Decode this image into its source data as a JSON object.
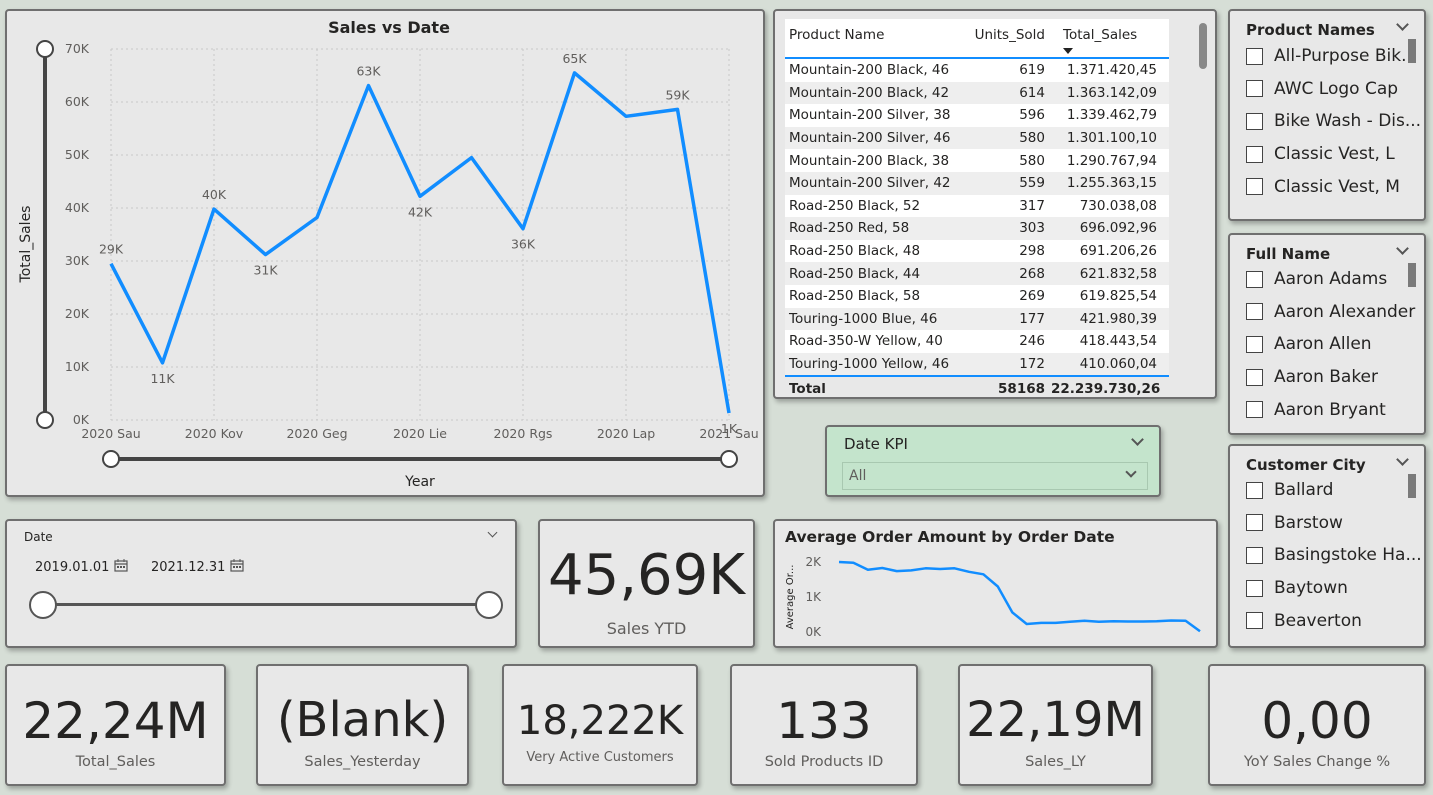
{
  "sales_chart": {
    "title": "Sales vs Date",
    "ylabel": "Total_Sales",
    "xlabel": "Year",
    "y_ticks": [
      "70K",
      "60K",
      "50K",
      "40K",
      "30K",
      "20K",
      "10K",
      "0K"
    ],
    "x_ticks": [
      "2020 Sau",
      "2020 Kov",
      "2020 Geg",
      "2020 Lie",
      "2020 Rgs",
      "2020 Lap",
      "2021 Sau"
    ]
  },
  "chart_data": [
    {
      "type": "line",
      "title": "Sales vs Date",
      "xlabel": "Year",
      "ylabel": "Total_Sales",
      "ylim": [
        0,
        70000
      ],
      "x_range": [
        "2020-01",
        "2021-01"
      ],
      "x": [
        "2020-01",
        "2020-02",
        "2020-03",
        "2020-04",
        "2020-05",
        "2020-06",
        "2020-07",
        "2020-08",
        "2020-09",
        "2020-10",
        "2020-11",
        "2020-12",
        "2021-01"
      ],
      "values": [
        29500,
        10800,
        39800,
        31200,
        38200,
        63100,
        42200,
        49500,
        36100,
        65500,
        57300,
        58600,
        1300
      ],
      "data_labels": [
        {
          "x": "2020-01",
          "text": "29K"
        },
        {
          "x": "2020-02",
          "text": "11K"
        },
        {
          "x": "2020-03",
          "text": "40K"
        },
        {
          "x": "2020-04",
          "text": "31K"
        },
        {
          "x": "2020-06",
          "text": "63K"
        },
        {
          "x": "2020-07",
          "text": "42K"
        },
        {
          "x": "2020-09",
          "text": "36K"
        },
        {
          "x": "2020-10",
          "text": "65K"
        },
        {
          "x": "2020-12",
          "text": "59K"
        },
        {
          "x": "2021-01",
          "text": "1K"
        }
      ],
      "grid": true,
      "color": "#118dff"
    },
    {
      "type": "line",
      "title": "Average Order Amount by Order Date",
      "ylabel": "Average Or...",
      "y_ticks": [
        "2K",
        "1K",
        "0K"
      ],
      "ylim": [
        0,
        2000
      ],
      "values": [
        2000,
        1980,
        1780,
        1830,
        1740,
        1760,
        1820,
        1800,
        1820,
        1720,
        1650,
        1300,
        560,
        230,
        260,
        260,
        290,
        320,
        290,
        310,
        300,
        300,
        310,
        330,
        320,
        20
      ],
      "grid": false,
      "color": "#118dff"
    }
  ],
  "product_table": {
    "headers": [
      "Product Name",
      "Units_Sold",
      "Total_Sales"
    ],
    "rows": [
      [
        "Mountain-200 Black, 46",
        "619",
        "1.371.420,45"
      ],
      [
        "Mountain-200 Black, 42",
        "614",
        "1.363.142,09"
      ],
      [
        "Mountain-200 Silver, 38",
        "596",
        "1.339.462,79"
      ],
      [
        "Mountain-200 Silver, 46",
        "580",
        "1.301.100,10"
      ],
      [
        "Mountain-200 Black, 38",
        "580",
        "1.290.767,94"
      ],
      [
        "Mountain-200 Silver, 42",
        "559",
        "1.255.363,15"
      ],
      [
        "Road-250 Black, 52",
        "317",
        "730.038,08"
      ],
      [
        "Road-250 Red, 58",
        "303",
        "696.092,96"
      ],
      [
        "Road-250 Black, 48",
        "298",
        "691.206,26"
      ],
      [
        "Road-250 Black, 44",
        "268",
        "621.832,58"
      ],
      [
        "Road-250 Black, 58",
        "269",
        "619.825,54"
      ],
      [
        "Touring-1000 Blue, 46",
        "177",
        "421.980,39"
      ],
      [
        "Road-350-W Yellow, 40",
        "246",
        "418.443,54"
      ],
      [
        "Touring-1000 Yellow, 46",
        "172",
        "410.060,04"
      ]
    ],
    "total": [
      "Total",
      "58168",
      "22.239.730,26"
    ]
  },
  "product_names_slicer": {
    "title": "Product Names",
    "items": [
      "All-Purpose Bik...",
      "AWC Logo Cap",
      "Bike Wash - Dis...",
      "Classic Vest, L",
      "Classic Vest, M"
    ]
  },
  "full_name_slicer": {
    "title": "Full Name",
    "items": [
      "Aaron Adams",
      "Aaron Alexander",
      "Aaron Allen",
      "Aaron Baker",
      "Aaron Bryant"
    ]
  },
  "customer_city_slicer": {
    "title": "Customer City",
    "items": [
      "Ballard",
      "Barstow",
      "Basingstoke Ha...",
      "Baytown",
      "Beaverton"
    ]
  },
  "date_kpi": {
    "title": "Date KPI",
    "selected": "All",
    "color": "#c4e4cc"
  },
  "date_slicer": {
    "title": "Date",
    "start": "2019.01.01",
    "end": "2021.12.31"
  },
  "kpis": {
    "sales_ytd": {
      "value": "45,69K",
      "label": "Sales YTD"
    },
    "total_sales": {
      "value": "22,24M",
      "label": "Total_Sales"
    },
    "sales_yesterday": {
      "value": "(Blank)",
      "label": "Sales_Yesterday"
    },
    "very_active": {
      "value": "18,222K",
      "label": "Very Active Customers"
    },
    "sold_products": {
      "value": "133",
      "label": "Sold Products ID"
    },
    "sales_ly": {
      "value": "22,19M",
      "label": "Sales_LY"
    },
    "yoy": {
      "value": "0,00",
      "label": "YoY Sales Change %"
    }
  },
  "avg_order_chart": {
    "title": "Average Order Amount by Order Date",
    "ylabel": "Average Or...",
    "y_ticks": [
      "2K",
      "1K",
      "0K"
    ]
  },
  "colors": {
    "accent": "#118dff",
    "card_bg": "#e8e8e8",
    "page_bg": "#d6ded6"
  }
}
